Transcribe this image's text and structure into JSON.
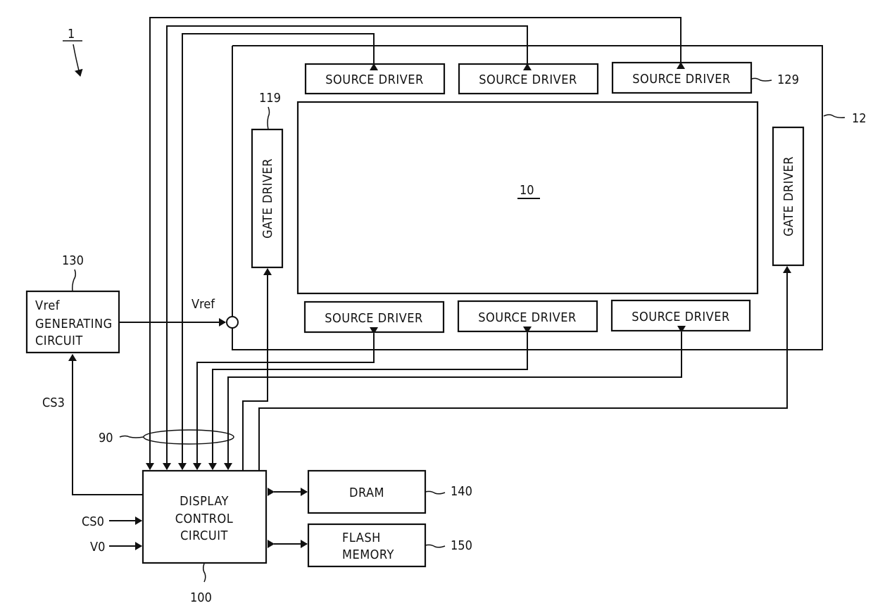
{
  "figure": {
    "ref_device": "1",
    "ref_panel_module": "12",
    "ref_display_panel": "10"
  },
  "blocks": {
    "source_driver_label": "SOURCE DRIVER",
    "source_driver_ref": "129",
    "gate_driver_label": "GATE DRIVER",
    "gate_driver_ref": "119",
    "vref_circuit": {
      "lines": [
        "Vref",
        "GENERATING",
        "CIRCUIT"
      ],
      "ref": "130"
    },
    "display_control": {
      "lines": [
        "DISPLAY",
        "CONTROL",
        "CIRCUIT"
      ],
      "ref": "100"
    },
    "dram": {
      "label": "DRAM",
      "ref": "140"
    },
    "flash": {
      "lines": [
        "FLASH",
        "MEMORY"
      ],
      "ref": "150"
    }
  },
  "signals": {
    "vref": "Vref",
    "cs3": "CS3",
    "cs0": "CS0",
    "v0": "V0",
    "bus_ref": "90"
  }
}
